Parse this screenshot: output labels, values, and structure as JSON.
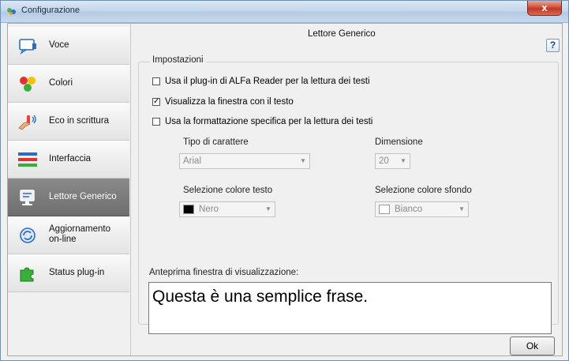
{
  "window": {
    "title": "Configurazione",
    "close_label": "x"
  },
  "sidebar": {
    "items": [
      {
        "label": "Voce",
        "icon": "monitor-speech-icon",
        "selected": false
      },
      {
        "label": "Colori",
        "icon": "color-dots-icon",
        "selected": false
      },
      {
        "label": "Eco in scrittura",
        "icon": "hand-sound-icon",
        "selected": false
      },
      {
        "label": "Interfaccia",
        "icon": "colored-bars-icon",
        "selected": false
      },
      {
        "label": "Lettore Generico",
        "icon": "monitor-reader-icon",
        "selected": true
      },
      {
        "label": "Aggiornamento\non-line",
        "icon": "update-globe-icon",
        "selected": false
      },
      {
        "label": "Status plug-in",
        "icon": "puzzle-piece-icon",
        "selected": false
      }
    ]
  },
  "panel": {
    "title": "Lettore Generico",
    "help_label": "?"
  },
  "settings": {
    "legend": "Impostazioni",
    "options": [
      {
        "label": "Usa il plug-in di ALFa Reader per la lettura dei testi",
        "checked": false
      },
      {
        "label": "Visualizza la finestra con il testo",
        "checked": true
      },
      {
        "label": "Usa la formattazione specifica per la lettura dei testi",
        "checked": false
      }
    ],
    "font_type_label": "Tipo di carattere",
    "font_type_value": "Arial",
    "size_label": "Dimensione",
    "size_value": "20",
    "text_color_label": "Selezione colore testo",
    "text_color_value": "Nero",
    "text_color_hex": "#000000",
    "bg_color_label": "Selezione colore sfondo",
    "bg_color_value": "Bianco",
    "bg_color_hex": "#ffffff"
  },
  "preview": {
    "label": "Anteprima finestra di visualizzazione:",
    "text": "Questa è una semplice frase."
  },
  "buttons": {
    "ok": "Ok"
  }
}
